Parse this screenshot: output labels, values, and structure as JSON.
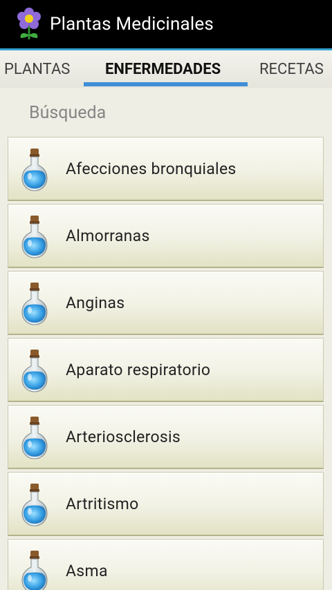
{
  "app": {
    "title": "Plantas Medicinales",
    "icon": "flower-icon"
  },
  "tabs": [
    {
      "label": "PLANTAS",
      "selected": false
    },
    {
      "label": "ENFERMEDADES",
      "selected": true
    },
    {
      "label": "RECETAS",
      "selected": false
    }
  ],
  "search": {
    "label": "Búsqueda"
  },
  "list": {
    "item_icon": "potion-bottle-icon",
    "items": [
      {
        "label": "Afecciones bronquiales"
      },
      {
        "label": "Almorranas"
      },
      {
        "label": "Anginas"
      },
      {
        "label": "Aparato respiratorio"
      },
      {
        "label": "Arteriosclerosis"
      },
      {
        "label": "Artritismo"
      },
      {
        "label": "Asma"
      }
    ]
  },
  "colors": {
    "accent": "#35a3d4",
    "tab_indicator": "#3f8fd6",
    "background": "#efeee4"
  }
}
